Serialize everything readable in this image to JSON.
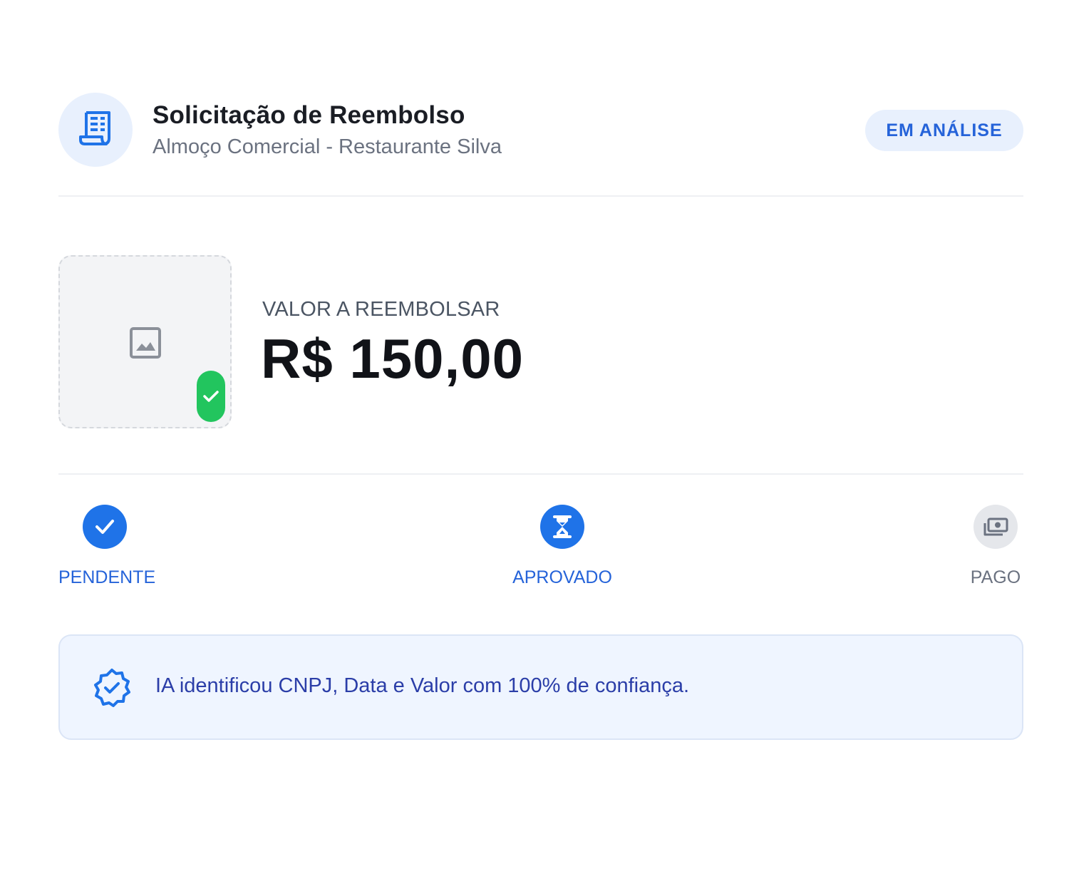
{
  "header": {
    "icon": "receipt-icon",
    "title": "Solicitação de Reembolso",
    "subtitle": "Almoço Comercial - Restaurante Silva",
    "status": "EM ANÁLISE"
  },
  "receipt": {
    "thumbnail_icon": "image-placeholder-icon",
    "verified_icon": "check-icon"
  },
  "amount": {
    "label": "VALOR A REEMBOLSAR",
    "value": "R$ 150,00"
  },
  "steps": [
    {
      "label": "PENDENTE",
      "icon": "check-icon",
      "state": "active"
    },
    {
      "label": "APROVADO",
      "icon": "hourglass-icon",
      "state": "active"
    },
    {
      "label": "PAGO",
      "icon": "payments-icon",
      "state": "inactive"
    }
  ],
  "ai_notice": {
    "icon": "verified-badge-icon",
    "text": "IA identificou CNPJ, Data e Valor com 100% de confiança."
  },
  "colors": {
    "accent": "#1f73e8",
    "badge_bg": "#e8f0fd",
    "success": "#22c55e",
    "info_bg": "#eff5ff",
    "info_text": "#2b3ea8"
  }
}
